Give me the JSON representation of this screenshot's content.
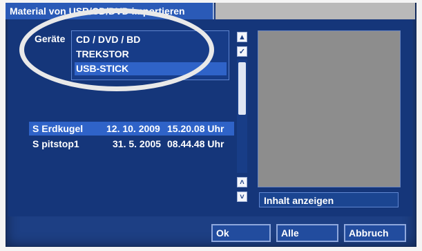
{
  "window": {
    "title": "Material von USB/CD/DVD importieren"
  },
  "devices": {
    "label": "Geräte",
    "items": [
      "CD / DVD / BD",
      "TREKSTOR",
      "USB-STICK"
    ],
    "selected_index": 2
  },
  "scroll": {
    "up_icon": "▲",
    "check_icon": "✓",
    "scroll_up_icon": "˄",
    "scroll_down_icon": "˅"
  },
  "files": [
    {
      "name": "S Erdkugel",
      "date": "12. 10. 2009",
      "time": "15.20.08 Uhr"
    },
    {
      "name": "S pitstop1",
      "date": "31. 5. 2005",
      "time": "08.44.48 Uhr"
    }
  ],
  "preview": {
    "show_button": "Inhalt anzeigen"
  },
  "buttons": {
    "ok": "Ok",
    "all": "Alle",
    "cancel": "Abbruch"
  }
}
